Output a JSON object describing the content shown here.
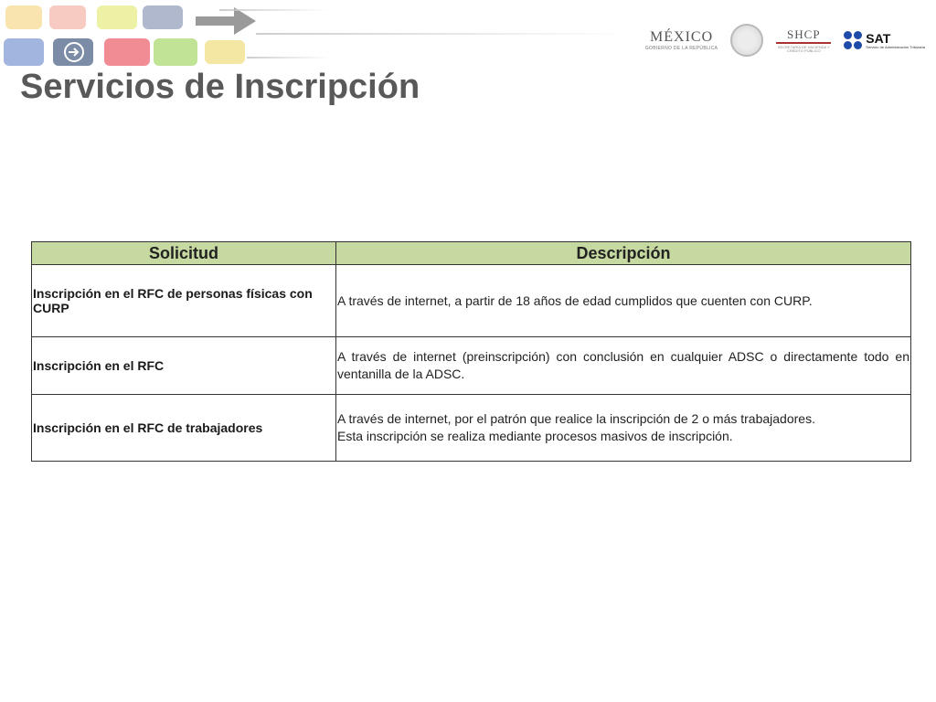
{
  "header": {
    "logos": {
      "mexico": "MÉXICO",
      "mexico_sub": "GOBIERNO DE LA REPÚBLICA",
      "shcp": "SHCP",
      "shcp_sub": "SECRETARÍA DE HACIENDA Y CRÉDITO PÚBLICO",
      "sat": "SAT",
      "sat_sub": "Servicio de Administración Tributaria"
    }
  },
  "page": {
    "title": "Servicios de Inscripción"
  },
  "table": {
    "headers": [
      "Solicitud",
      "Descripción"
    ],
    "rows": [
      {
        "solicitud": "Inscripción en el RFC de personas físicas con CURP",
        "descripcion": [
          "A través de internet, a partir de 18 años de edad cumplidos que cuenten con CURP."
        ]
      },
      {
        "solicitud": "Inscripción en el RFC",
        "descripcion": [
          "A través de internet (preinscripción) con conclusión en cualquier ADSC o directamente todo en ventanilla de la ADSC."
        ]
      },
      {
        "solicitud": "Inscripción en el RFC de trabajadores",
        "descripcion": [
          "A través de internet, por el patrón que realice la inscripción de 2 o más trabajadores.",
          "Esta  inscripción se realiza  mediante  procesos masivos de inscripción."
        ]
      }
    ]
  }
}
